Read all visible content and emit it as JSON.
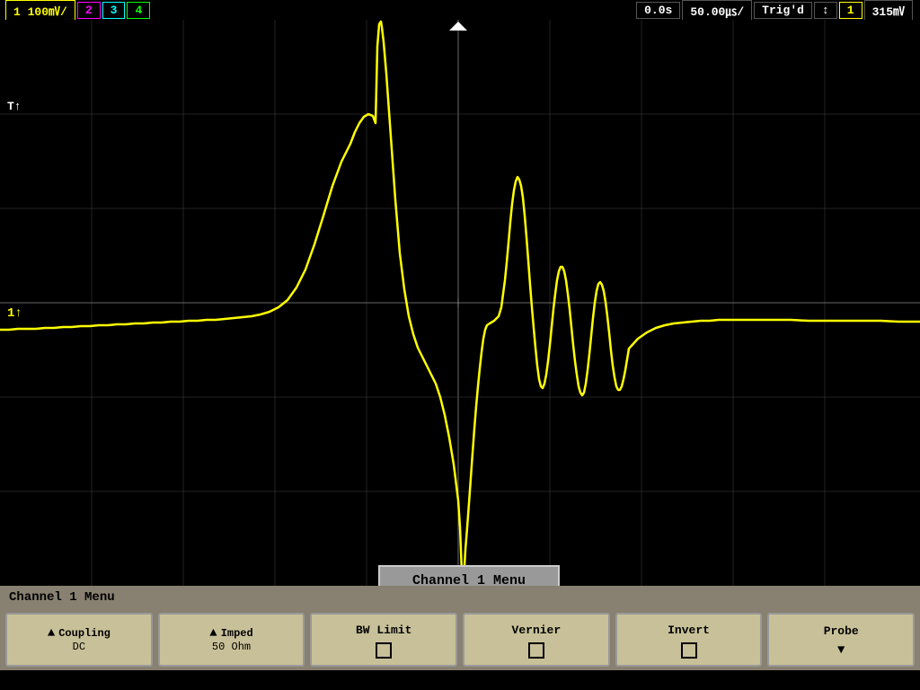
{
  "topbar": {
    "ch1": "1  100㎷/",
    "ch2": "2",
    "ch3": "3",
    "ch4": "4",
    "time": "0.0s",
    "timebase": "50.00㎲/",
    "trig_status": "Trig'd",
    "trig_icon": "↕",
    "trig_ch": "1",
    "trig_level": "315㎷"
  },
  "screen": {
    "ch1_label": "1↑",
    "trig_label": "T↑",
    "ch1_menu_popup": "Channel 1  Menu",
    "grid_color": "#444",
    "waveform_color": "#ffff00"
  },
  "status_bar": {
    "text": "Channel 1  Menu"
  },
  "bottom_menu": {
    "btn1": {
      "arrow": "▲",
      "label": "Coupling",
      "sub": "DC"
    },
    "btn2": {
      "arrow": "▲",
      "label": "Imped",
      "sub": "50 Ohm"
    },
    "btn3": {
      "label": "BW Limit"
    },
    "btn4": {
      "label": "Vernier"
    },
    "btn5": {
      "label": "Invert"
    },
    "btn6": {
      "label": "Probe",
      "arrow": "▼"
    }
  }
}
